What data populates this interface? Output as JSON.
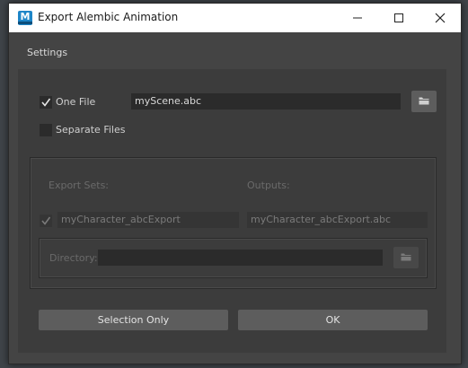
{
  "window": {
    "title": "Export Alembic Animation",
    "app_icon_letter": "M"
  },
  "menu": {
    "settings": "Settings"
  },
  "one_file": {
    "label": "One File",
    "checked": true,
    "filename": "myScene.abc"
  },
  "separate_files": {
    "label": "Separate Files",
    "checked": false
  },
  "group": {
    "export_sets_label": "Export Sets:",
    "outputs_label": "Outputs:",
    "rows": [
      {
        "checked": true,
        "set_name": "myCharacter_abcExport",
        "output": "myCharacter_abcExport.abc"
      }
    ],
    "directory_label": "Directory:",
    "directory_value": ""
  },
  "buttons": {
    "selection_only": "Selection Only",
    "ok": "OK"
  },
  "icons": {
    "browse": "folder-icon",
    "minimize": "minimize-icon",
    "maximize": "maximize-icon",
    "close": "close-icon"
  }
}
